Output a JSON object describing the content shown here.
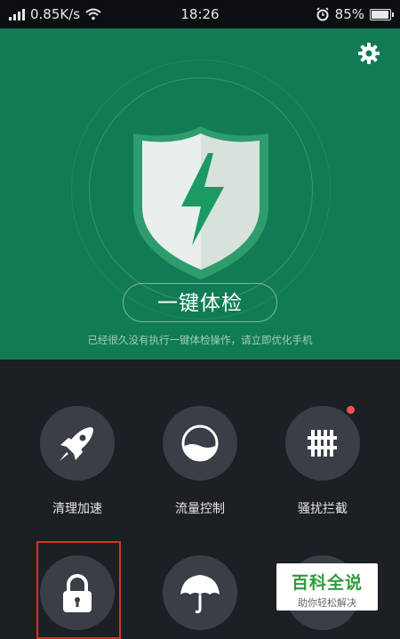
{
  "status_bar": {
    "network_speed": "0.85K/s",
    "time": "18:26",
    "battery": "85%",
    "icons": [
      "signal-icon",
      "wifi-icon",
      "alarm-icon",
      "battery-icon"
    ]
  },
  "hero": {
    "settings_icon": "gear-icon",
    "shield_icon": "shield-lightning-icon",
    "checkup_button": "一键体检",
    "hint": "已经很久没有执行一键体检操作，请立即优化手机",
    "colors": {
      "background": "#117c54",
      "shield": "#e9efec",
      "bolt": "#1c9a63"
    }
  },
  "tiles": [
    {
      "label": "清理加速",
      "icon": "rocket-icon"
    },
    {
      "label": "流量控制",
      "icon": "data-usage-icon"
    },
    {
      "label": "骚扰拦截",
      "icon": "fence-icon",
      "badge": true
    },
    {
      "label": "",
      "icon": "lock-icon",
      "highlighted": true
    },
    {
      "label": "",
      "icon": "umbrella-icon"
    },
    {
      "label": "",
      "icon": "partial-icon"
    }
  ],
  "watermark": {
    "title": "百科全说",
    "subtitle": "助你轻松解决"
  }
}
